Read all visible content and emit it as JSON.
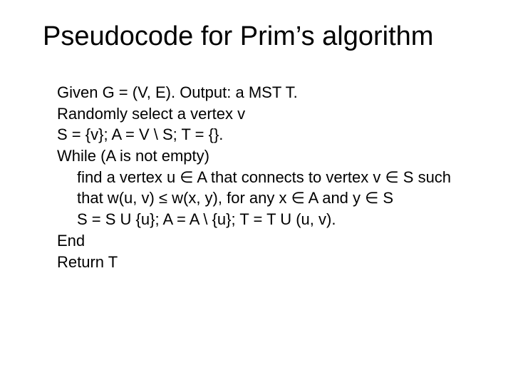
{
  "title": "Pseudocode for Prim’s algorithm",
  "lines": {
    "l1": "Given G = (V, E). Output: a MST T.",
    "l2": "Randomly select a vertex v",
    "l3": "S = {v}; A = V \\ S; T = {}.",
    "l4": "While (A is not empty)",
    "l5": "find a vertex u ∈ A that connects to vertex v ∈ S such",
    "l6": "that w(u, v) ≤ w(x, y), for any x ∈ A and y ∈ S",
    "l7": "S = S U {u}; A = A \\ {u}; T = T U (u, v).",
    "l8": "End",
    "l9": "Return T"
  }
}
